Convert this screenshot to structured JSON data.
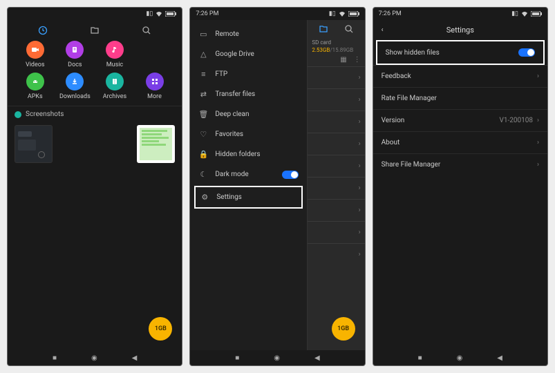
{
  "statusbar": {
    "time": "7:26 PM"
  },
  "screen1": {
    "tiles": [
      {
        "label": "Videos",
        "icon": "video-icon"
      },
      {
        "label": "Docs",
        "icon": "docs-icon"
      },
      {
        "label": "Music",
        "icon": "music-icon"
      },
      {
        "label": "APKs",
        "icon": "apk-icon"
      },
      {
        "label": "Downloads",
        "icon": "download-icon"
      },
      {
        "label": "Archives",
        "icon": "archive-icon"
      },
      {
        "label": "More",
        "icon": "more-icon"
      }
    ],
    "section_label": "Screenshots",
    "fab_label": "1GB"
  },
  "screen2": {
    "drawer": [
      {
        "label": "Remote",
        "icon": "remote-icon"
      },
      {
        "label": "Google Drive",
        "icon": "drive-icon"
      },
      {
        "label": "FTP",
        "icon": "ftp-icon"
      },
      {
        "label": "Transfer files",
        "icon": "transfer-icon"
      },
      {
        "label": "Deep clean",
        "icon": "clean-icon"
      },
      {
        "label": "Favorites",
        "icon": "heart-icon"
      },
      {
        "label": "Hidden folders",
        "icon": "lock-icon"
      },
      {
        "label": "Dark mode",
        "icon": "moon-icon",
        "toggle": true
      },
      {
        "label": "Settings",
        "icon": "gear-icon",
        "highlight": true
      }
    ],
    "sd": {
      "label": "SD card",
      "used": "2.53GB",
      "total": "15.89GB"
    },
    "fab_label": "1GB"
  },
  "screen3": {
    "title": "Settings",
    "items": [
      {
        "label": "Show hidden files",
        "toggle": true,
        "highlight": true
      },
      {
        "label": "Feedback"
      },
      {
        "label": "Rate File Manager"
      },
      {
        "label": "Version",
        "value": "V1-200108"
      },
      {
        "label": "About"
      },
      {
        "label": "Share File Manager"
      }
    ]
  }
}
